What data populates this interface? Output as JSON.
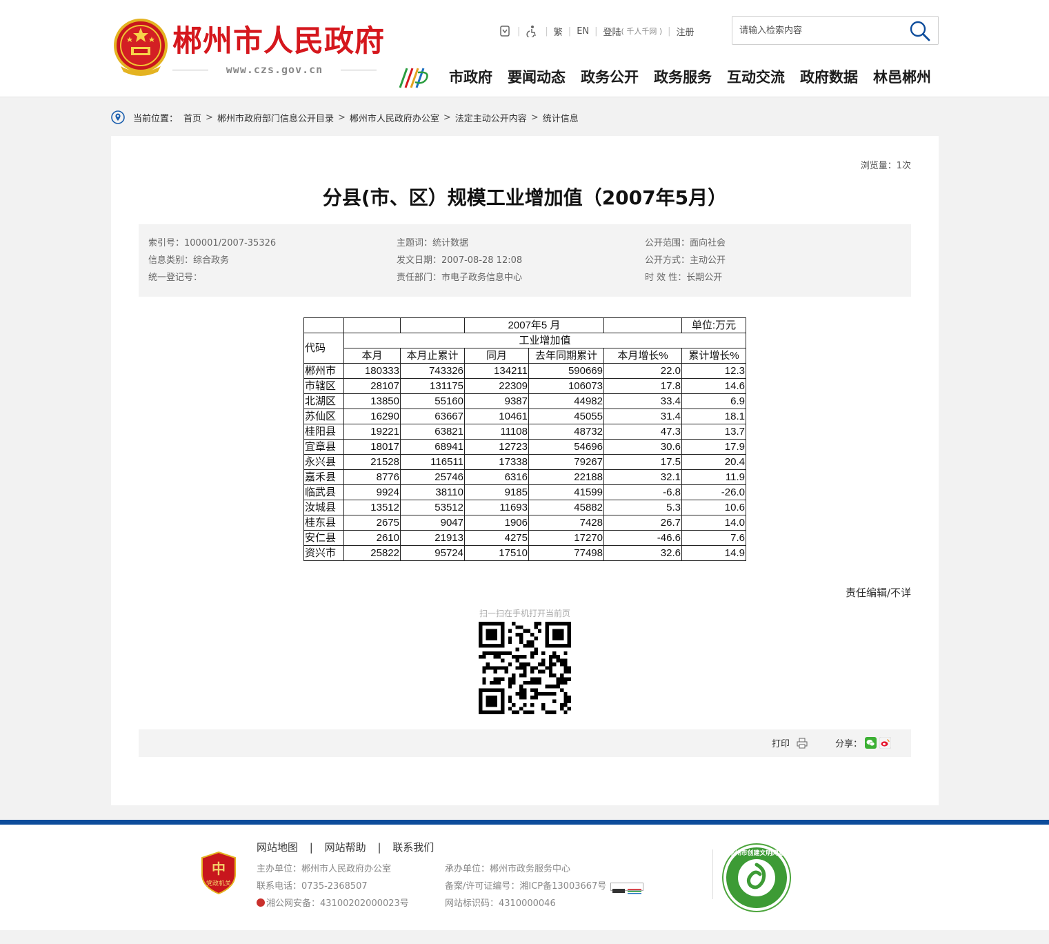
{
  "header": {
    "site_name": "郴州市人民政府",
    "domain": "www.czs.gov.cn",
    "toplinks": {
      "traditional": "繁",
      "english": "EN",
      "login": "登陆",
      "login_sub": "( 千人千网 )",
      "register": "注册"
    },
    "search": {
      "placeholder": "请输入检索内容"
    },
    "nav": [
      "市政府",
      "要闻动态",
      "政务公开",
      "政务服务",
      "互动交流",
      "政府数据",
      "林邑郴州"
    ]
  },
  "breadcrumb": {
    "label": "当前位置：",
    "items": [
      "首页",
      "郴州市政府部门信息公开目录",
      "郴州市人民政府办公室",
      "法定主动公开内容",
      "统计信息"
    ]
  },
  "article": {
    "views": "浏览量：1次",
    "title": "分县(市、区）规模工业增加值（2007年5月）",
    "meta": {
      "index_no": "索引号：100001/2007-35326",
      "theme": "主题词：统计数据",
      "scope": "公开范围：面向社会",
      "category": "信息类别：综合政务",
      "date": "发文日期：2007-08-28 12:08",
      "method": "公开方式：主动公开",
      "reg_no": "统一登记号：",
      "dept": "责任部门：市电子政务信息中心",
      "validity": "时 效 性：长期公开"
    },
    "table": {
      "period": "2007年5 月",
      "unit": "单位:万元",
      "code_header": "代码",
      "group_header": "工业增加值",
      "columns": [
        "本月",
        "本月止累计",
        "同月",
        "去年同期累计",
        "本月增长%",
        "累计增长%"
      ],
      "rows": [
        [
          "郴州市",
          "180333",
          "743326",
          "134211",
          "590669",
          "22.0",
          "12.3"
        ],
        [
          "市辖区",
          "28107",
          "131175",
          "22309",
          "106073",
          "17.8",
          "14.6"
        ],
        [
          "北湖区",
          "13850",
          "55160",
          "9387",
          "44982",
          "33.4",
          "6.9"
        ],
        [
          "苏仙区",
          "16290",
          "63667",
          "10461",
          "45055",
          "31.4",
          "18.1"
        ],
        [
          "桂阳县",
          "19221",
          "63821",
          "11108",
          "48732",
          "47.3",
          "13.7"
        ],
        [
          "宜章县",
          "18017",
          "68941",
          "12723",
          "54696",
          "30.6",
          "17.9"
        ],
        [
          "永兴县",
          "21528",
          "116511",
          "17338",
          "79267",
          "17.5",
          "20.4"
        ],
        [
          "嘉禾县",
          "8776",
          "25746",
          "6316",
          "22188",
          "32.1",
          "11.9"
        ],
        [
          "临武县",
          "9924",
          "38110",
          "9185",
          "41599",
          "-6.8",
          "-26.0"
        ],
        [
          "汝城县",
          "13512",
          "53512",
          "11693",
          "45882",
          "5.3",
          "10.6"
        ],
        [
          "桂东县",
          "2675",
          "9047",
          "1906",
          "7428",
          "26.7",
          "14.0"
        ],
        [
          "安仁县",
          "2610",
          "21913",
          "4275",
          "17270",
          "-46.6",
          "7.6"
        ],
        [
          "资兴市",
          "25822",
          "95724",
          "17510",
          "77498",
          "32.6",
          "14.9"
        ]
      ]
    },
    "editor": "责任编辑/不详",
    "scan_text": "扫一扫在手机打开当前页",
    "print_label": "打印",
    "share_label": "分享："
  },
  "footer": {
    "links": [
      "网站地图",
      "网站帮助",
      "联系我们"
    ],
    "host": "主办单位：郴州市人民政府办公室",
    "phone": "联系电话：0735-2368507",
    "police": "湘公网安备：43100202000023号",
    "operator": "承办单位：郴州市政务服务中心",
    "icp": "备案/许可证编号：湘ICP备13003667号",
    "site_code": "网站标识码：4310000046",
    "badge_text": "党政机关",
    "civil_text": "郴州市创建文明网站"
  },
  "colors": {
    "brand_red": "#d5171d",
    "footer_blue": "#0d4c9b",
    "nav_text": "#1c1c1c"
  }
}
